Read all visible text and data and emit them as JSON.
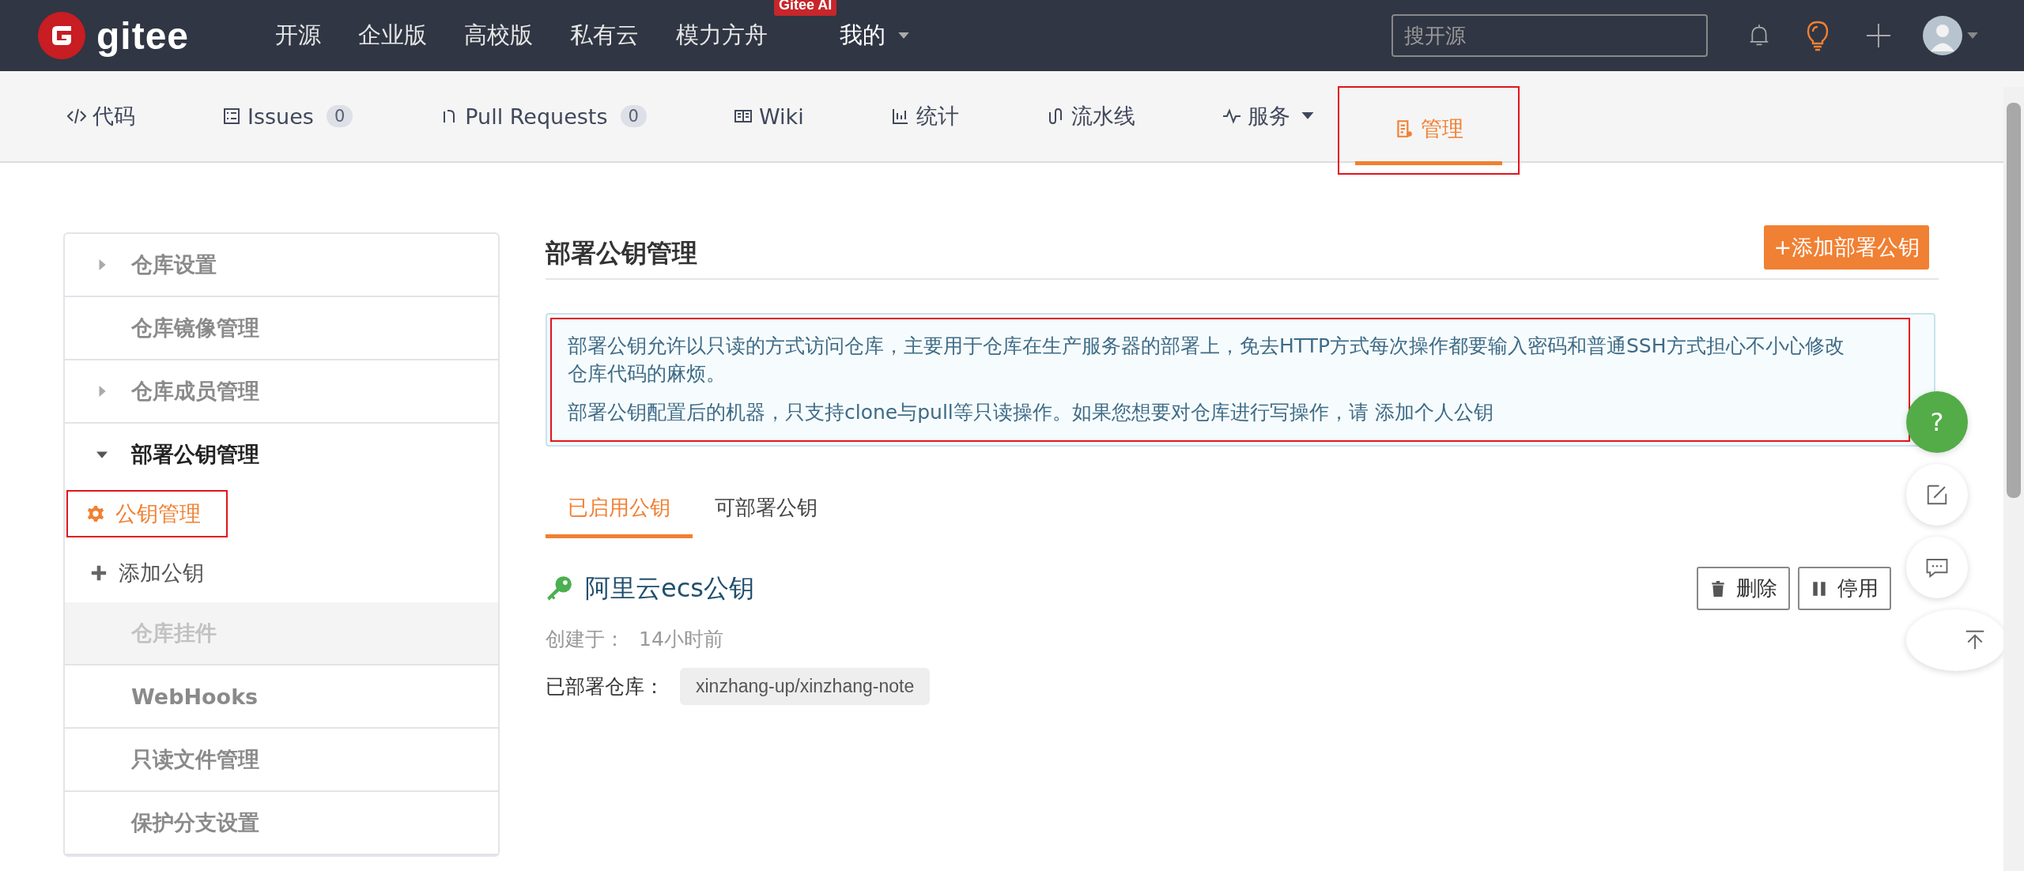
{
  "nav": {
    "logo": "gitee",
    "links": [
      {
        "label": "开源"
      },
      {
        "label": "企业版"
      },
      {
        "label": "高校版"
      },
      {
        "label": "私有云"
      },
      {
        "label": "模力方舟",
        "badge": "Gitee AI"
      },
      {
        "label": "我的",
        "dropdown": true
      }
    ],
    "search": {
      "placeholder": "搜开源"
    }
  },
  "repo_tabs": [
    {
      "label": "代码",
      "selected": false
    },
    {
      "label": "Issues",
      "count": "0",
      "selected": false
    },
    {
      "label": "Pull Requests",
      "count": "0",
      "selected": false
    },
    {
      "label": "Wiki",
      "selected": false
    },
    {
      "label": "统计",
      "selected": false
    },
    {
      "label": "流水线",
      "selected": false
    },
    {
      "label": "服务",
      "dropdown": true,
      "selected": false
    },
    {
      "label": "管理",
      "selected": true
    }
  ],
  "sidebar": {
    "items": [
      {
        "kind": "group",
        "label": "仓库设置",
        "expanded": false
      },
      {
        "kind": "link",
        "label": "仓库镜像管理"
      },
      {
        "kind": "group",
        "label": "仓库成员管理",
        "expanded": false
      },
      {
        "kind": "group",
        "label": "部署公钥管理",
        "expanded": true,
        "children": [
          {
            "label": "公钥管理",
            "selected": true
          },
          {
            "label": "添加公钥",
            "selected": false
          }
        ]
      },
      {
        "kind": "disabled",
        "label": "仓库挂件"
      },
      {
        "kind": "link",
        "label": "WebHooks"
      },
      {
        "kind": "link",
        "label": "只读文件管理"
      },
      {
        "kind": "link",
        "label": "保护分支设置"
      }
    ]
  },
  "main": {
    "title": "部署公钥管理",
    "add_button": "+添加部署公钥",
    "notice": [
      "部署公钥允许以只读的方式访问仓库，主要用于仓库在生产服务器的部署上，免去HTTP方式每次操作都要输入密码和普通SSH方式担心不小心修改仓库代码的麻烦。",
      "部署公钥配置后的机器，只支持clone与pull等只读操作。如果您想要对仓库进行写操作，请 添加个人公钥"
    ],
    "tabs": [
      {
        "label": "已启用公钥",
        "selected": true
      },
      {
        "label": "可部署公钥",
        "selected": false
      }
    ],
    "key": {
      "name": "阿里云ecs公钥",
      "created_label": "创建于：",
      "created_value": "14小时前",
      "repo_label": "已部署仓库：",
      "repo": "xinzhang-up/xinzhang-note",
      "actions": [
        "删除",
        "停用"
      ]
    }
  },
  "float_buttons": [
    {
      "kind": "help",
      "label": "?"
    },
    {
      "kind": "edit"
    },
    {
      "kind": "chat"
    },
    {
      "kind": "top"
    }
  ]
}
